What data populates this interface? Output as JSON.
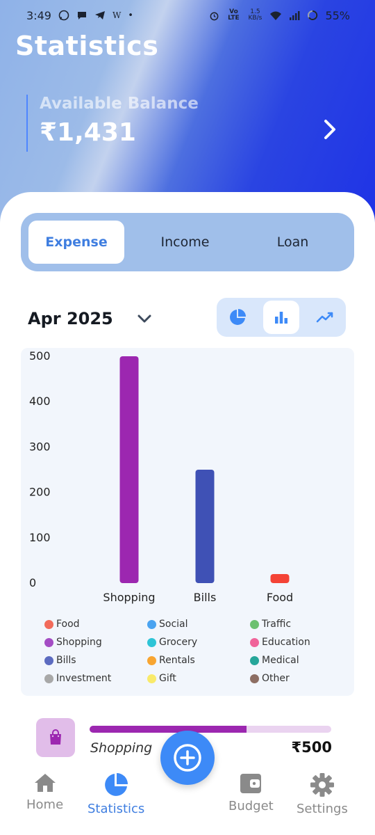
{
  "status_bar": {
    "time": "3:49",
    "battery": "55%",
    "net_speed_value": "1.5",
    "net_speed_unit": "KB/s",
    "lte_label": "Vo LTE"
  },
  "header": {
    "title": "Statistics",
    "balance_label": "Available Balance",
    "balance_amount": "₹1,431"
  },
  "tabs": [
    {
      "label": "Expense",
      "active": true
    },
    {
      "label": "Income",
      "active": false
    },
    {
      "label": "Loan",
      "active": false
    }
  ],
  "period": {
    "month": "Apr 2025"
  },
  "chart_types": {
    "pie": "pie-chart-icon",
    "bar": "bar-chart-icon",
    "line": "line-chart-icon",
    "selected": "bar"
  },
  "chart_data": {
    "type": "bar",
    "categories": [
      "Shopping",
      "Bills",
      "Food"
    ],
    "values": [
      500,
      250,
      20
    ],
    "colors": [
      "#9c27b0",
      "#3f51b5",
      "#f44336"
    ],
    "title": "",
    "xlabel": "",
    "ylabel": "",
    "ylim": [
      0,
      500
    ],
    "yticks": [
      "500",
      "400",
      "300",
      "200",
      "100",
      "0"
    ],
    "grid": false
  },
  "legend": [
    {
      "label": "Food",
      "color": "#f26b5b"
    },
    {
      "label": "Social",
      "color": "#4aa3f0"
    },
    {
      "label": "Traffic",
      "color": "#6cc070"
    },
    {
      "label": "Shopping",
      "color": "#a44dc4"
    },
    {
      "label": "Grocery",
      "color": "#2ec4d6"
    },
    {
      "label": "Education",
      "color": "#f0649a"
    },
    {
      "label": "Bills",
      "color": "#5c6bc0"
    },
    {
      "label": "Rentals",
      "color": "#f8a531"
    },
    {
      "label": "Medical",
      "color": "#26a69a"
    },
    {
      "label": "Investment",
      "color": "#a8a8a8"
    },
    {
      "label": "Gift",
      "color": "#f9ea6a"
    },
    {
      "label": "Other",
      "color": "#8d6e63"
    }
  ],
  "category_row": {
    "name": "Shopping",
    "amount": "₹500",
    "progress": 0.65,
    "icon": "shopping-bag-icon"
  },
  "nav": {
    "home": "Home",
    "statistics": "Statistics",
    "budget": "Budget",
    "settings": "Settings",
    "active": "statistics"
  },
  "colors": {
    "accent": "#3f7ee0",
    "fab": "#3d8af7",
    "shopping": "#9c27b0",
    "bills": "#3f51b5",
    "food": "#f44336"
  }
}
